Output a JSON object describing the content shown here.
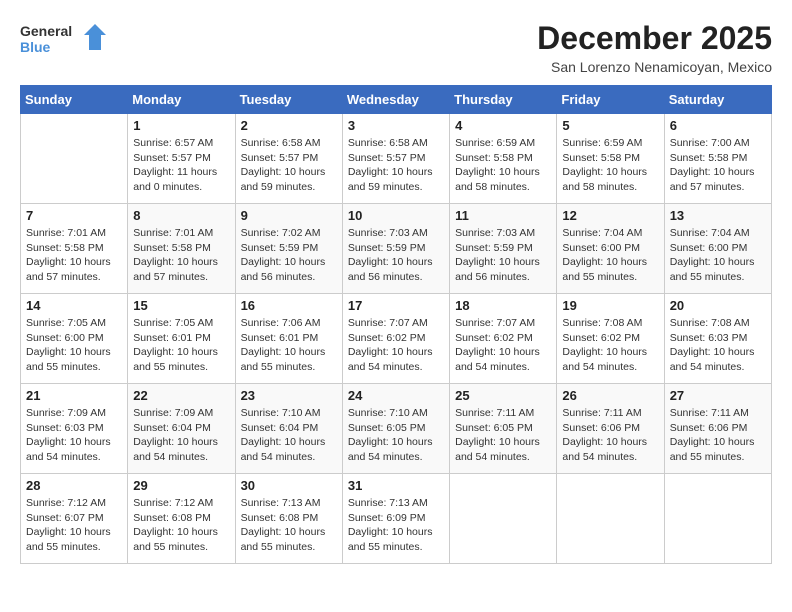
{
  "logo": {
    "general": "General",
    "blue": "Blue"
  },
  "title": "December 2025",
  "location": "San Lorenzo Nenamicoyan, Mexico",
  "days_header": [
    "Sunday",
    "Monday",
    "Tuesday",
    "Wednesday",
    "Thursday",
    "Friday",
    "Saturday"
  ],
  "weeks": [
    [
      {
        "day": "",
        "info": ""
      },
      {
        "day": "1",
        "info": "Sunrise: 6:57 AM\nSunset: 5:57 PM\nDaylight: 11 hours\nand 0 minutes."
      },
      {
        "day": "2",
        "info": "Sunrise: 6:58 AM\nSunset: 5:57 PM\nDaylight: 10 hours\nand 59 minutes."
      },
      {
        "day": "3",
        "info": "Sunrise: 6:58 AM\nSunset: 5:57 PM\nDaylight: 10 hours\nand 59 minutes."
      },
      {
        "day": "4",
        "info": "Sunrise: 6:59 AM\nSunset: 5:58 PM\nDaylight: 10 hours\nand 58 minutes."
      },
      {
        "day": "5",
        "info": "Sunrise: 6:59 AM\nSunset: 5:58 PM\nDaylight: 10 hours\nand 58 minutes."
      },
      {
        "day": "6",
        "info": "Sunrise: 7:00 AM\nSunset: 5:58 PM\nDaylight: 10 hours\nand 57 minutes."
      }
    ],
    [
      {
        "day": "7",
        "info": "Sunrise: 7:01 AM\nSunset: 5:58 PM\nDaylight: 10 hours\nand 57 minutes."
      },
      {
        "day": "8",
        "info": "Sunrise: 7:01 AM\nSunset: 5:58 PM\nDaylight: 10 hours\nand 57 minutes."
      },
      {
        "day": "9",
        "info": "Sunrise: 7:02 AM\nSunset: 5:59 PM\nDaylight: 10 hours\nand 56 minutes."
      },
      {
        "day": "10",
        "info": "Sunrise: 7:03 AM\nSunset: 5:59 PM\nDaylight: 10 hours\nand 56 minutes."
      },
      {
        "day": "11",
        "info": "Sunrise: 7:03 AM\nSunset: 5:59 PM\nDaylight: 10 hours\nand 56 minutes."
      },
      {
        "day": "12",
        "info": "Sunrise: 7:04 AM\nSunset: 6:00 PM\nDaylight: 10 hours\nand 55 minutes."
      },
      {
        "day": "13",
        "info": "Sunrise: 7:04 AM\nSunset: 6:00 PM\nDaylight: 10 hours\nand 55 minutes."
      }
    ],
    [
      {
        "day": "14",
        "info": "Sunrise: 7:05 AM\nSunset: 6:00 PM\nDaylight: 10 hours\nand 55 minutes."
      },
      {
        "day": "15",
        "info": "Sunrise: 7:05 AM\nSunset: 6:01 PM\nDaylight: 10 hours\nand 55 minutes."
      },
      {
        "day": "16",
        "info": "Sunrise: 7:06 AM\nSunset: 6:01 PM\nDaylight: 10 hours\nand 55 minutes."
      },
      {
        "day": "17",
        "info": "Sunrise: 7:07 AM\nSunset: 6:02 PM\nDaylight: 10 hours\nand 54 minutes."
      },
      {
        "day": "18",
        "info": "Sunrise: 7:07 AM\nSunset: 6:02 PM\nDaylight: 10 hours\nand 54 minutes."
      },
      {
        "day": "19",
        "info": "Sunrise: 7:08 AM\nSunset: 6:02 PM\nDaylight: 10 hours\nand 54 minutes."
      },
      {
        "day": "20",
        "info": "Sunrise: 7:08 AM\nSunset: 6:03 PM\nDaylight: 10 hours\nand 54 minutes."
      }
    ],
    [
      {
        "day": "21",
        "info": "Sunrise: 7:09 AM\nSunset: 6:03 PM\nDaylight: 10 hours\nand 54 minutes."
      },
      {
        "day": "22",
        "info": "Sunrise: 7:09 AM\nSunset: 6:04 PM\nDaylight: 10 hours\nand 54 minutes."
      },
      {
        "day": "23",
        "info": "Sunrise: 7:10 AM\nSunset: 6:04 PM\nDaylight: 10 hours\nand 54 minutes."
      },
      {
        "day": "24",
        "info": "Sunrise: 7:10 AM\nSunset: 6:05 PM\nDaylight: 10 hours\nand 54 minutes."
      },
      {
        "day": "25",
        "info": "Sunrise: 7:11 AM\nSunset: 6:05 PM\nDaylight: 10 hours\nand 54 minutes."
      },
      {
        "day": "26",
        "info": "Sunrise: 7:11 AM\nSunset: 6:06 PM\nDaylight: 10 hours\nand 54 minutes."
      },
      {
        "day": "27",
        "info": "Sunrise: 7:11 AM\nSunset: 6:06 PM\nDaylight: 10 hours\nand 55 minutes."
      }
    ],
    [
      {
        "day": "28",
        "info": "Sunrise: 7:12 AM\nSunset: 6:07 PM\nDaylight: 10 hours\nand 55 minutes."
      },
      {
        "day": "29",
        "info": "Sunrise: 7:12 AM\nSunset: 6:08 PM\nDaylight: 10 hours\nand 55 minutes."
      },
      {
        "day": "30",
        "info": "Sunrise: 7:13 AM\nSunset: 6:08 PM\nDaylight: 10 hours\nand 55 minutes."
      },
      {
        "day": "31",
        "info": "Sunrise: 7:13 AM\nSunset: 6:09 PM\nDaylight: 10 hours\nand 55 minutes."
      },
      {
        "day": "",
        "info": ""
      },
      {
        "day": "",
        "info": ""
      },
      {
        "day": "",
        "info": ""
      }
    ]
  ]
}
